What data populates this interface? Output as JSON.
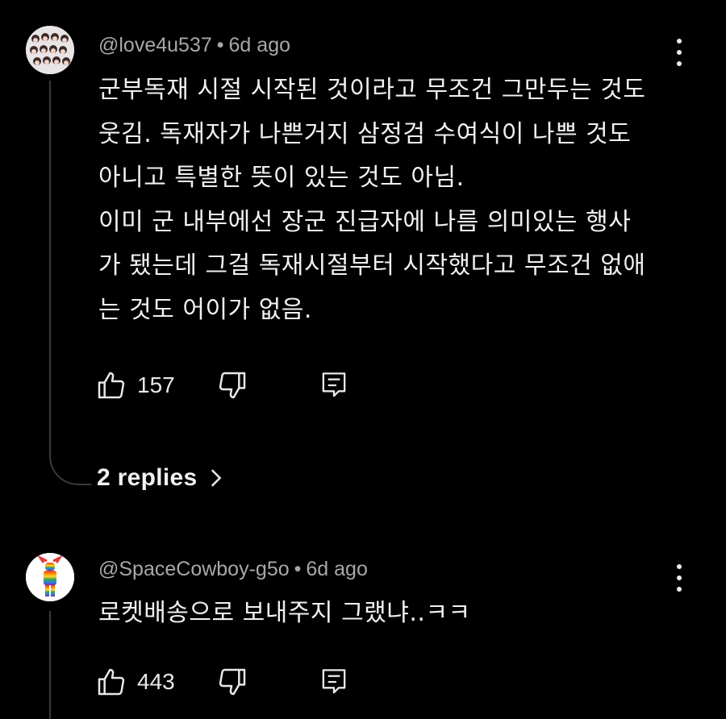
{
  "comments": [
    {
      "author": "@love4u537",
      "time": "6d ago",
      "lines": [
        "군부독재 시절 시작된 것이라고 무조건 그만두는 것도",
        "웃김. 독재자가 나쁜거지 삼정검 수여식이 나쁜 것도",
        "아니고 특별한 뜻이 있는 것도 아님.",
        "이미 군 내부에선 장군 진급자에 나름 의미있는 행사",
        "가 됐는데 그걸 독재시절부터 시작했다고 무조건 없애",
        "는 것도 어이가 없음."
      ],
      "likes": "157",
      "replies_label": "2 replies"
    },
    {
      "author": "@SpaceCowboy-g5o",
      "time": "6d ago",
      "lines": [
        "로켓배송으로 보내주지 그랬냐..ㅋㅋ"
      ],
      "likes": "443"
    }
  ],
  "meta_separator": "•",
  "icons": [
    "thumbs-up-icon",
    "thumbs-down-icon",
    "reply-icon",
    "more-vertical-icon",
    "chevron-right-icon"
  ],
  "colors": {
    "background": "#000000",
    "text": "#f1f1f1",
    "meta": "#a8a8a8",
    "thread_line": "#3a3a3a"
  }
}
